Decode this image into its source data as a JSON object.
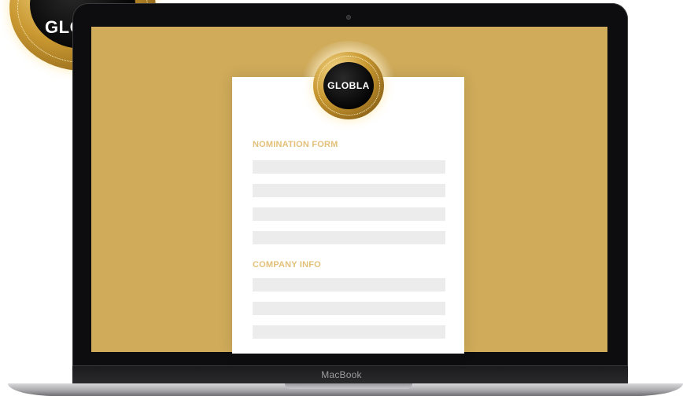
{
  "laptop": {
    "brand_label": "MacBook"
  },
  "badge": {
    "logo_text": "GLOBLA"
  },
  "form": {
    "sections": [
      {
        "title": "NOMINATION FORM",
        "field_count": 4
      },
      {
        "title": "COMPANY INFO",
        "field_count": 3
      }
    ]
  },
  "colors": {
    "screen_background": "#cfab5a",
    "section_title": "#e3c079",
    "field_background": "#ececec",
    "badge_gold": "#c99831"
  },
  "icons": [
    "globla-badge-icon",
    "camera-icon"
  ]
}
